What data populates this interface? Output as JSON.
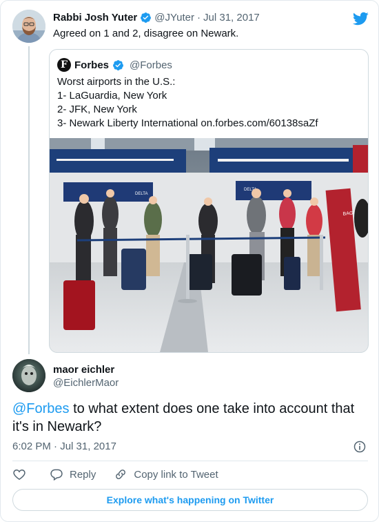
{
  "parent_tweet": {
    "author_name": "Rabbi Josh Yuter",
    "handle": "@JYuter",
    "separator": "·",
    "date": "Jul 31, 2017",
    "text": "Agreed on 1 and 2, disagree on Newark."
  },
  "quoted_tweet": {
    "author_name": "Forbes",
    "handle": "@Forbes",
    "logo_letter": "F",
    "lines": [
      "Worst airports in the U.S.:",
      "1- LaGuardia, New York",
      "2- JFK, New York",
      "3- Newark Liberty International on.forbes.com/60138saZf"
    ],
    "photo": {
      "sign_left": "DELTA",
      "sign_mid": "DELTA",
      "baggage_sign": "BAGGAGE"
    }
  },
  "reply_tweet": {
    "author_name": "maor eichler",
    "handle": "@EichlerMaor",
    "mention": "@Forbes",
    "text": " to what extent does one take into account that it's in Newark?",
    "time": "6:02 PM",
    "separator": "·",
    "date": "Jul 31, 2017"
  },
  "actions": {
    "reply_label": "Reply",
    "copy_label": "Copy link to Tweet"
  },
  "explore_label": "Explore what's happening on Twitter",
  "colors": {
    "accent": "#1d9bf0",
    "text": "#0f1419",
    "secondary": "#536471",
    "border": "#cfd9de"
  },
  "icons": [
    "verified-badge-icon",
    "twitter-bird-icon",
    "info-icon",
    "heart-icon",
    "reply-icon",
    "link-icon"
  ]
}
